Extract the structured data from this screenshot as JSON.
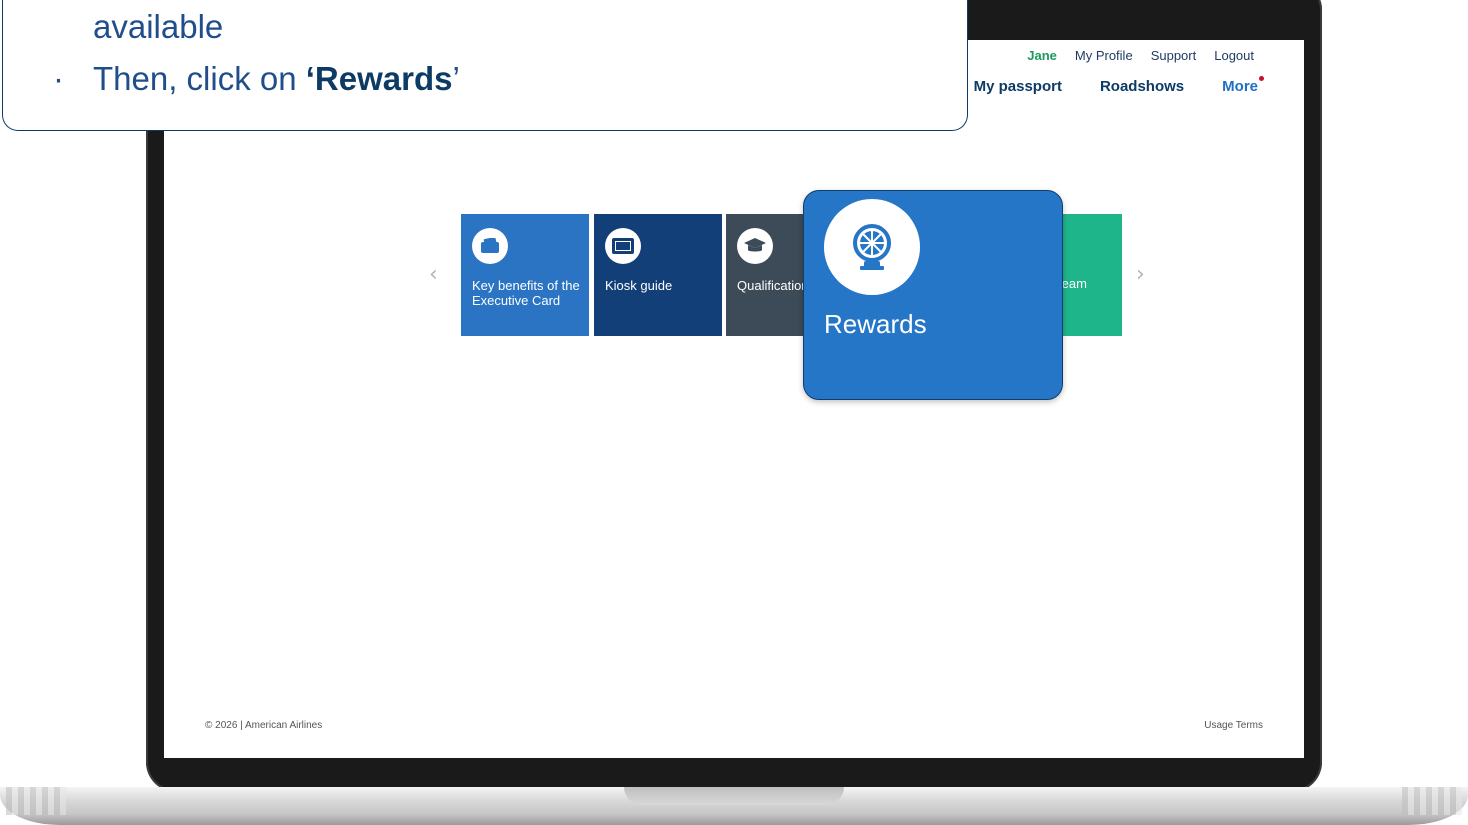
{
  "callout": {
    "line1": "available",
    "bullet": "·",
    "line2_prefix": "Then, click on ",
    "line2_emphasis": "‘Rewards",
    "line2_suffix": "’"
  },
  "header": {
    "user_name": "Jane",
    "links": [
      "My Profile",
      "Support",
      "Logout"
    ],
    "nav": [
      "My passport",
      "Roadshows",
      "More"
    ]
  },
  "carousel": {
    "prev_arrow": "‹",
    "next_arrow": "›",
    "tiles": [
      {
        "label": "Key benefits of the Executive Card",
        "icon": "card-icon",
        "color": "#2a74c3"
      },
      {
        "label": "Kiosk guide",
        "icon": "kiosk-icon",
        "color": "#123f77"
      },
      {
        "label": "Qualification guide",
        "icon": "graduation-cap-icon",
        "color": "#3d4b58"
      },
      {
        "label": "team",
        "icon": "team-icon",
        "color": "#1db589"
      }
    ],
    "highlighted": {
      "label": "Rewards",
      "icon": "prize-wheel-icon",
      "color": "#2576c6"
    }
  },
  "footer": {
    "copyright": "© 2026 | American Airlines",
    "terms": "Usage Terms"
  }
}
